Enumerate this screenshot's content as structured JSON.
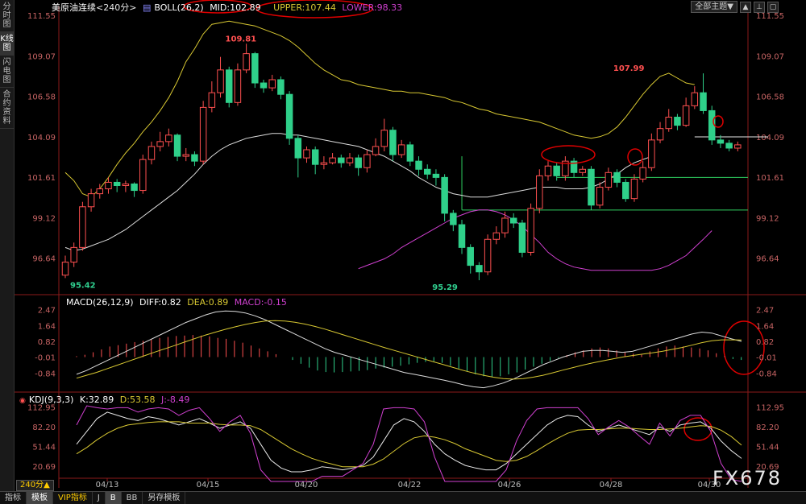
{
  "sidebar": {
    "tabs": [
      {
        "label": "分时图",
        "active": false
      },
      {
        "label": "K线图",
        "active": true
      },
      {
        "label": "闪电图",
        "active": false
      },
      {
        "label": "合约资料",
        "active": false
      }
    ]
  },
  "header": {
    "symbol": "美原油连续",
    "period": "<240分>",
    "boll_label": "BOLL(26,2)",
    "mid_label": "MID:102.89",
    "upper_label": "UPPER:107.44",
    "lower_label": "LOWER:98.33",
    "theme_button": "全部主题▼"
  },
  "macd_header": {
    "label": "MACD(26,12,9)",
    "diff": "DIFF:0.82",
    "dea": "DEA:0.89",
    "macd": "MACD:-0.15"
  },
  "kdj_header": {
    "label": "KDJ(9,3,3)",
    "k": "K:32.89",
    "d": "D:53.58",
    "j": "J:-8.49"
  },
  "period_button": "240分▲",
  "bottom_tabs": [
    {
      "label": "指标",
      "active": false
    },
    {
      "label": "模板",
      "active": true
    },
    {
      "label": "VIP指标",
      "active": false
    },
    {
      "label": "J",
      "active": false
    },
    {
      "label": "B",
      "active": true
    },
    {
      "label": "BB",
      "active": false
    },
    {
      "label": "另存模板",
      "active": false
    }
  ],
  "watermark": "FX678",
  "colors": {
    "up": "#ff5050",
    "down": "#2fd08a",
    "upper_band": "#d8c832",
    "mid_band": "#dcdcdc",
    "lower_band": "#d040d0",
    "axis_text": "#c86464",
    "highlight": "#e00000"
  },
  "chart_data": [
    {
      "type": "candlestick",
      "title": "美原油连续 <240分>",
      "y_ticks": [
        "111.55",
        "109.07",
        "106.58",
        "104.09",
        "101.61",
        "99.12",
        "96.64"
      ],
      "ylim": [
        94.6,
        111.9
      ],
      "x_ticks": [
        "04/13",
        "04/15",
        "04/20",
        "04/22",
        "04/26",
        "04/28",
        "04/30"
      ],
      "annotations": [
        {
          "text": "109.81",
          "index": 18,
          "value": 109.81,
          "kind": "high"
        },
        {
          "text": "95.42",
          "index": 0,
          "value": 95.42,
          "kind": "low"
        },
        {
          "text": "95.29",
          "index": 42,
          "value": 95.29,
          "kind": "low"
        },
        {
          "text": "107.99",
          "index": 63,
          "value": 107.99,
          "kind": "high"
        }
      ],
      "candles": [
        [
          95.6,
          96.4,
          96.8,
          95.42
        ],
        [
          96.4,
          97.3,
          97.6,
          96.1
        ],
        [
          97.3,
          99.8,
          100.1,
          97.1
        ],
        [
          99.8,
          100.6,
          100.9,
          99.5
        ],
        [
          100.6,
          100.9,
          101.2,
          100.3
        ],
        [
          100.9,
          101.3,
          101.6,
          100.6
        ],
        [
          101.3,
          101.1,
          101.5,
          100.7
        ],
        [
          101.1,
          101.2,
          101.4,
          100.7
        ],
        [
          101.2,
          100.8,
          101.3,
          100.4
        ],
        [
          100.8,
          102.7,
          103.0,
          100.6
        ],
        [
          102.7,
          103.5,
          103.8,
          102.4
        ],
        [
          103.5,
          103.8,
          104.4,
          103.2
        ],
        [
          103.8,
          104.2,
          104.6,
          103.5
        ],
        [
          104.2,
          102.9,
          104.3,
          102.6
        ],
        [
          102.9,
          103.0,
          103.4,
          102.6
        ],
        [
          103.0,
          102.6,
          103.2,
          102.3
        ],
        [
          102.6,
          105.9,
          106.3,
          102.4
        ],
        [
          105.9,
          106.8,
          107.5,
          105.6
        ],
        [
          106.8,
          108.2,
          109.0,
          106.5
        ],
        [
          108.2,
          106.2,
          108.4,
          105.9
        ],
        [
          106.2,
          108.2,
          108.6,
          106.0
        ],
        [
          108.2,
          109.2,
          109.81,
          108.0
        ],
        [
          109.2,
          107.4,
          109.3,
          107.1
        ],
        [
          107.4,
          107.1,
          107.6,
          106.8
        ],
        [
          107.1,
          107.6,
          107.9,
          106.9
        ],
        [
          107.6,
          106.7,
          107.8,
          106.4
        ],
        [
          106.7,
          104.0,
          106.9,
          103.6
        ],
        [
          104.0,
          102.8,
          104.2,
          101.6
        ],
        [
          102.8,
          103.3,
          103.5,
          102.5
        ],
        [
          103.3,
          102.4,
          103.5,
          101.8
        ],
        [
          102.4,
          102.5,
          102.9,
          102.1
        ],
        [
          102.5,
          102.8,
          103.1,
          102.4
        ],
        [
          102.8,
          102.5,
          103.0,
          102.2
        ],
        [
          102.5,
          102.8,
          103.1,
          102.3
        ],
        [
          102.8,
          102.2,
          103.0,
          101.7
        ],
        [
          102.2,
          103.0,
          103.3,
          101.9
        ],
        [
          103.0,
          103.5,
          104.0,
          102.9
        ],
        [
          103.5,
          104.5,
          105.2,
          103.2
        ],
        [
          104.5,
          103.0,
          104.7,
          102.6
        ],
        [
          103.0,
          103.6,
          103.9,
          102.8
        ],
        [
          103.6,
          102.6,
          103.8,
          102.3
        ],
        [
          102.6,
          102.1,
          102.9,
          101.7
        ],
        [
          102.1,
          101.8,
          102.4,
          101.5
        ],
        [
          101.8,
          101.6,
          102.1,
          101.1
        ],
        [
          101.6,
          99.4,
          101.8,
          98.9
        ],
        [
          99.4,
          98.7,
          99.6,
          98.3
        ],
        [
          98.7,
          97.3,
          99.0,
          96.9
        ],
        [
          97.3,
          96.2,
          97.5,
          95.7
        ],
        [
          96.2,
          95.8,
          96.4,
          95.29
        ],
        [
          95.8,
          97.8,
          98.1,
          95.6
        ],
        [
          97.8,
          98.2,
          98.6,
          97.5
        ],
        [
          98.2,
          99.1,
          99.5,
          97.9
        ],
        [
          99.1,
          98.8,
          99.4,
          98.5
        ],
        [
          98.8,
          97.0,
          99.0,
          96.7
        ],
        [
          97.0,
          99.7,
          100.0,
          96.8
        ],
        [
          99.7,
          101.7,
          102.1,
          99.4
        ],
        [
          101.7,
          102.3,
          102.6,
          101.4
        ],
        [
          102.3,
          101.7,
          102.5,
          101.4
        ],
        [
          101.7,
          102.6,
          102.9,
          101.4
        ],
        [
          102.6,
          101.9,
          102.8,
          101.6
        ],
        [
          101.9,
          102.1,
          102.3,
          101.7
        ],
        [
          102.1,
          99.9,
          102.3,
          99.6
        ],
        [
          99.9,
          101.0,
          101.3,
          99.7
        ],
        [
          101.0,
          101.9,
          102.2,
          100.8
        ],
        [
          101.9,
          101.3,
          102.1,
          101.0
        ],
        [
          101.3,
          100.3,
          101.5,
          100.1
        ],
        [
          100.3,
          101.5,
          101.8,
          100.1
        ],
        [
          101.5,
          102.2,
          102.6,
          101.3
        ],
        [
          102.2,
          103.9,
          104.3,
          102.0
        ],
        [
          103.9,
          104.6,
          105.0,
          103.7
        ],
        [
          104.6,
          105.3,
          105.8,
          104.4
        ],
        [
          105.3,
          104.8,
          105.5,
          104.5
        ],
        [
          104.8,
          106.0,
          106.5,
          104.7
        ],
        [
          106.0,
          106.8,
          107.2,
          105.8
        ],
        [
          106.8,
          105.7,
          107.99,
          105.5
        ],
        [
          105.7,
          103.9,
          106.0,
          103.6
        ],
        [
          103.9,
          103.7,
          104.2,
          103.4
        ],
        [
          103.7,
          103.4,
          103.9,
          103.2
        ],
        [
          103.4,
          103.6,
          103.8,
          103.2
        ]
      ],
      "upper_band": [
        101.9,
        101.4,
        100.6,
        100.4,
        100.9,
        101.6,
        102.4,
        103.1,
        103.7,
        104.4,
        105.0,
        105.7,
        106.5,
        107.5,
        108.7,
        109.5,
        110.4,
        111.0,
        111.1,
        111.2,
        111.1,
        111.0,
        110.9,
        110.7,
        110.5,
        110.3,
        110.0,
        109.6,
        109.1,
        108.6,
        108.2,
        107.9,
        107.6,
        107.5,
        107.3,
        107.2,
        107.1,
        107.0,
        106.9,
        106.9,
        106.8,
        106.8,
        106.7,
        106.6,
        106.5,
        106.3,
        106.2,
        106.0,
        105.8,
        105.7,
        105.5,
        105.4,
        105.3,
        105.2,
        105.1,
        105.0,
        104.8,
        104.6,
        104.4,
        104.2,
        104.1,
        104.0,
        104.1,
        104.3,
        104.7,
        105.3,
        106.0,
        106.7,
        107.3,
        107.8,
        108.0,
        107.7,
        107.4,
        107.3
      ],
      "mid_band": [
        97.3,
        97.1,
        97.2,
        97.4,
        97.6,
        97.8,
        98.1,
        98.4,
        98.8,
        99.2,
        99.6,
        100.0,
        100.4,
        100.8,
        101.3,
        101.8,
        102.4,
        102.9,
        103.3,
        103.6,
        103.8,
        104.0,
        104.1,
        104.2,
        104.3,
        104.3,
        104.2,
        104.2,
        104.1,
        104.0,
        103.9,
        103.8,
        103.7,
        103.6,
        103.5,
        103.3,
        103.1,
        102.9,
        102.6,
        102.3,
        102.0,
        101.6,
        101.3,
        101.0,
        100.8,
        100.6,
        100.5,
        100.4,
        100.4,
        100.4,
        100.5,
        100.6,
        100.7,
        100.8,
        100.9,
        101.0,
        101.0,
        101.0,
        100.9,
        100.9,
        100.9,
        101.0,
        101.2,
        101.5,
        101.8,
        102.2,
        102.5,
        102.7,
        102.89
      ],
      "lower_band": [
        96.0,
        96.2,
        96.4,
        96.6,
        96.9,
        97.3,
        97.6,
        97.9,
        98.2,
        98.5,
        98.8,
        99.1,
        99.3,
        99.5,
        99.6,
        99.6,
        99.5,
        99.3,
        99.0,
        98.6,
        98.1,
        97.6,
        97.0,
        96.6,
        96.3,
        96.1,
        96.0,
        95.9,
        95.9,
        95.9,
        95.9,
        95.9,
        95.9,
        95.9,
        95.9,
        96.0,
        96.2,
        96.5,
        96.8,
        97.3,
        97.8,
        98.33
      ],
      "reference_lines": [
        101.6,
        99.6,
        104.09
      ],
      "series": [
        {
          "name": "UPPER",
          "value": 107.44
        },
        {
          "name": "MID",
          "value": 102.89
        },
        {
          "name": "LOWER",
          "value": 98.33
        }
      ]
    },
    {
      "type": "bar",
      "title": "MACD(26,12,9)",
      "y_ticks": [
        "2.47",
        "1.64",
        "0.82",
        "-0.01",
        "-0.84"
      ],
      "ylim": [
        -1.7,
        2.75
      ],
      "macd_bars": [
        0.05,
        0.12,
        0.25,
        0.4,
        0.55,
        0.62,
        0.7,
        0.78,
        0.85,
        0.92,
        1.0,
        1.05,
        1.1,
        1.12,
        1.15,
        1.12,
        1.08,
        1.0,
        0.95,
        0.85,
        0.75,
        0.6,
        0.45,
        0.3,
        0.15,
        0.0,
        -0.15,
        -0.35,
        -0.55,
        -0.7,
        -0.78,
        -0.8,
        -0.78,
        -0.75,
        -0.72,
        -0.68,
        -0.6,
        -0.55,
        -0.5,
        -0.45,
        -0.38,
        -0.3,
        -0.25,
        -0.22,
        -0.3,
        -0.45,
        -0.6,
        -0.75,
        -0.9,
        -1.0,
        -1.05,
        -1.0,
        -0.9,
        -0.8,
        -0.65,
        -0.5,
        -0.35,
        -0.2,
        -0.05,
        0.1,
        0.25,
        0.35,
        0.45,
        0.5,
        0.45,
        0.35,
        0.25,
        0.18,
        0.12,
        0.3,
        0.45,
        0.55,
        0.6,
        0.55,
        0.5,
        0.45,
        0.35,
        0.2,
        0.05,
        -0.1,
        -0.15
      ],
      "diff": [
        -0.9,
        -0.7,
        -0.45,
        -0.2,
        0.05,
        0.3,
        0.55,
        0.8,
        1.05,
        1.3,
        1.55,
        1.8,
        2.0,
        2.2,
        2.35,
        2.4,
        2.38,
        2.3,
        2.15,
        1.95,
        1.7,
        1.45,
        1.2,
        0.95,
        0.7,
        0.45,
        0.25,
        0.1,
        -0.05,
        -0.2,
        -0.35,
        -0.5,
        -0.65,
        -0.8,
        -0.9,
        -1.0,
        -1.1,
        -1.2,
        -1.32,
        -1.45,
        -1.55,
        -1.6,
        -1.5,
        -1.35,
        -1.15,
        -0.9,
        -0.65,
        -0.4,
        -0.2,
        0.0,
        0.15,
        0.3,
        0.35,
        0.35,
        0.3,
        0.25,
        0.3,
        0.45,
        0.6,
        0.75,
        0.9,
        1.05,
        1.2,
        1.3,
        1.25,
        1.1,
        0.95,
        0.82
      ],
      "dea": [
        -1.1,
        -0.95,
        -0.8,
        -0.62,
        -0.44,
        -0.26,
        -0.08,
        0.1,
        0.28,
        0.45,
        0.62,
        0.8,
        0.98,
        1.15,
        1.3,
        1.45,
        1.58,
        1.7,
        1.8,
        1.88,
        1.9,
        1.88,
        1.82,
        1.72,
        1.6,
        1.46,
        1.3,
        1.14,
        0.98,
        0.82,
        0.66,
        0.5,
        0.35,
        0.2,
        0.05,
        -0.1,
        -0.25,
        -0.4,
        -0.55,
        -0.7,
        -0.83,
        -0.95,
        -1.05,
        -1.12,
        -1.15,
        -1.12,
        -1.05,
        -0.95,
        -0.82,
        -0.68,
        -0.55,
        -0.42,
        -0.3,
        -0.2,
        -0.1,
        0.0,
        0.08,
        0.15,
        0.22,
        0.3,
        0.4,
        0.5,
        0.62,
        0.75,
        0.85,
        0.9,
        0.9,
        0.89
      ]
    },
    {
      "type": "line",
      "title": "KDJ(9,3,3)",
      "y_ticks": [
        "112.95",
        "82.20",
        "51.44",
        "20.69"
      ],
      "ylim": [
        2,
        120
      ],
      "series": [
        {
          "name": "K",
          "values": [
            55,
            75,
            95,
            105,
            100,
            95,
            92,
            98,
            95,
            90,
            85,
            90,
            95,
            88,
            80,
            85,
            90,
            80,
            55,
            30,
            18,
            12,
            12,
            15,
            20,
            18,
            15,
            18,
            22,
            35,
            60,
            85,
            95,
            90,
            75,
            55,
            40,
            30,
            22,
            18,
            15,
            15,
            25,
            40,
            55,
            70,
            85,
            95,
            100,
            98,
            85,
            75,
            80,
            85,
            80,
            75,
            70,
            82,
            75,
            85,
            88,
            90,
            80,
            60,
            45,
            32.89
          ]
        },
        {
          "name": "D",
          "values": [
            40,
            50,
            62,
            72,
            80,
            85,
            87,
            89,
            90,
            90,
            90,
            88,
            88,
            88,
            86,
            85,
            85,
            84,
            78,
            68,
            58,
            48,
            40,
            33,
            28,
            24,
            20,
            20,
            20,
            24,
            32,
            44,
            56,
            65,
            68,
            66,
            62,
            56,
            48,
            42,
            36,
            30,
            28,
            30,
            36,
            45,
            55,
            64,
            72,
            77,
            78,
            78,
            79,
            80,
            80,
            79,
            78,
            78,
            79,
            80,
            82,
            84,
            83,
            77,
            67,
            53.58
          ]
        },
        {
          "name": "J",
          "values": [
            85,
            115,
            112,
            110,
            112,
            112,
            105,
            110,
            112,
            110,
            100,
            108,
            112,
            95,
            75,
            90,
            100,
            72,
            15,
            -5,
            -8,
            -10,
            -8,
            -5,
            5,
            5,
            5,
            15,
            25,
            55,
            110,
            112,
            112,
            110,
            90,
            35,
            -5,
            -8,
            -8,
            -8,
            -8,
            -5,
            15,
            60,
            92,
            110,
            112,
            112,
            112,
            112,
            95,
            70,
            82,
            92,
            82,
            68,
            55,
            88,
            68,
            92,
            100,
            100,
            75,
            25,
            0,
            -8.49
          ]
        }
      ]
    }
  ]
}
